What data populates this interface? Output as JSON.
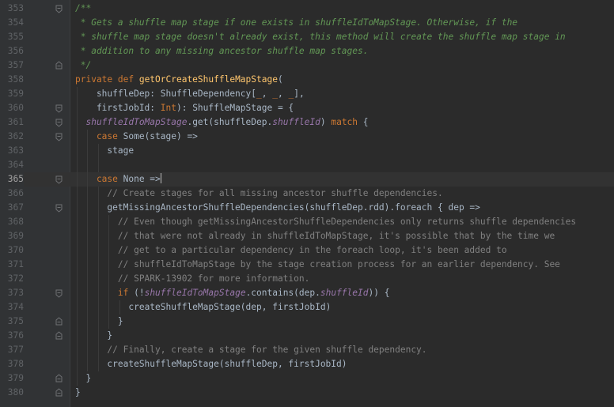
{
  "editor": {
    "current_line": 365,
    "lines": [
      {
        "num": "353",
        "fold": "fold-open",
        "indent": 0,
        "guides": [],
        "tokens": [
          {
            "t": "/**",
            "c": "doc"
          }
        ]
      },
      {
        "num": "354",
        "fold": "",
        "indent": 0,
        "guides": [],
        "tokens": [
          {
            "t": " * Gets a shuffle map stage if one exists in shuffleIdToMapStage. Otherwise, if the",
            "c": "doc"
          }
        ]
      },
      {
        "num": "355",
        "fold": "",
        "indent": 0,
        "guides": [],
        "tokens": [
          {
            "t": " * shuffle map stage doesn't already exist, this method will create the shuffle map stage in",
            "c": "doc"
          }
        ]
      },
      {
        "num": "356",
        "fold": "",
        "indent": 0,
        "guides": [],
        "tokens": [
          {
            "t": " * addition to any missing ancestor shuffle map stages.",
            "c": "doc"
          }
        ]
      },
      {
        "num": "357",
        "fold": "fold-close",
        "indent": 0,
        "guides": [],
        "tokens": [
          {
            "t": " */",
            "c": "doc"
          }
        ]
      },
      {
        "num": "358",
        "fold": "",
        "indent": 0,
        "guides": [],
        "tokens": [
          {
            "t": "private def ",
            "c": "kw"
          },
          {
            "t": "getOrCreateShuffleMapStage",
            "c": "fn"
          },
          {
            "t": "(",
            "c": "id"
          }
        ]
      },
      {
        "num": "359",
        "fold": "",
        "indent": 4,
        "guides": [
          0
        ],
        "tokens": [
          {
            "t": "shuffleDep: ShuffleDependency[",
            "c": "id"
          },
          {
            "t": "_",
            "c": "kw"
          },
          {
            "t": ", ",
            "c": "id"
          },
          {
            "t": "_",
            "c": "kw"
          },
          {
            "t": ", ",
            "c": "id"
          },
          {
            "t": "_",
            "c": "kw"
          },
          {
            "t": "],",
            "c": "id"
          }
        ]
      },
      {
        "num": "360",
        "fold": "fold-open",
        "indent": 4,
        "guides": [
          0
        ],
        "tokens": [
          {
            "t": "firstJobId: ",
            "c": "id"
          },
          {
            "t": "Int",
            "c": "kw"
          },
          {
            "t": "): ShuffleMapStage = {",
            "c": "id"
          }
        ]
      },
      {
        "num": "361",
        "fold": "fold-open",
        "indent": 2,
        "guides": [
          0
        ],
        "tokens": [
          {
            "t": "shuffleIdToMapStage",
            "c": "field"
          },
          {
            "t": ".get(shuffleDep.",
            "c": "id"
          },
          {
            "t": "shuffleId",
            "c": "field"
          },
          {
            "t": ") ",
            "c": "id"
          },
          {
            "t": "match",
            "c": "kw"
          },
          {
            "t": " {",
            "c": "id"
          }
        ]
      },
      {
        "num": "362",
        "fold": "fold-open",
        "indent": 4,
        "guides": [
          0,
          2
        ],
        "tokens": [
          {
            "t": "case ",
            "c": "kw"
          },
          {
            "t": "Some(stage) =>",
            "c": "id"
          }
        ]
      },
      {
        "num": "363",
        "fold": "",
        "indent": 6,
        "guides": [
          0,
          2,
          4
        ],
        "tokens": [
          {
            "t": "stage",
            "c": "id"
          }
        ]
      },
      {
        "num": "364",
        "fold": "",
        "indent": 0,
        "guides": [
          0,
          2,
          4
        ],
        "tokens": []
      },
      {
        "num": "365",
        "fold": "fold-open",
        "indent": 4,
        "guides": [
          0,
          2
        ],
        "caret": true,
        "tokens": [
          {
            "t": "case ",
            "c": "kw"
          },
          {
            "t": "None =>",
            "c": "id"
          }
        ]
      },
      {
        "num": "366",
        "fold": "",
        "indent": 6,
        "guides": [
          0,
          2,
          4
        ],
        "tokens": [
          {
            "t": "// Create stages for all missing ancestor shuffle dependencies.",
            "c": "cm"
          }
        ]
      },
      {
        "num": "367",
        "fold": "fold-open",
        "indent": 6,
        "guides": [
          0,
          2,
          4
        ],
        "tokens": [
          {
            "t": "getMissingAncestorShuffleDependencies(shuffleDep.rdd).foreach { dep =>",
            "c": "id"
          }
        ]
      },
      {
        "num": "368",
        "fold": "",
        "indent": 8,
        "guides": [
          0,
          2,
          4,
          6
        ],
        "tokens": [
          {
            "t": "// Even though getMissingAncestorShuffleDependencies only returns shuffle dependencies",
            "c": "cm"
          }
        ]
      },
      {
        "num": "369",
        "fold": "",
        "indent": 8,
        "guides": [
          0,
          2,
          4,
          6
        ],
        "tokens": [
          {
            "t": "// that were not already in shuffleIdToMapStage, it's possible that by the time we",
            "c": "cm"
          }
        ]
      },
      {
        "num": "370",
        "fold": "",
        "indent": 8,
        "guides": [
          0,
          2,
          4,
          6
        ],
        "tokens": [
          {
            "t": "// get to a particular dependency in the foreach loop, it's been added to",
            "c": "cm"
          }
        ]
      },
      {
        "num": "371",
        "fold": "",
        "indent": 8,
        "guides": [
          0,
          2,
          4,
          6
        ],
        "tokens": [
          {
            "t": "// shuffleIdToMapStage by the stage creation process for an earlier dependency. See",
            "c": "cm"
          }
        ]
      },
      {
        "num": "372",
        "fold": "",
        "indent": 8,
        "guides": [
          0,
          2,
          4,
          6
        ],
        "tokens": [
          {
            "t": "// SPARK-13902 for more information.",
            "c": "cm"
          }
        ]
      },
      {
        "num": "373",
        "fold": "fold-open",
        "indent": 8,
        "guides": [
          0,
          2,
          4,
          6
        ],
        "tokens": [
          {
            "t": "if ",
            "c": "kw"
          },
          {
            "t": "(!",
            "c": "id"
          },
          {
            "t": "shuffleIdToMapStage",
            "c": "field"
          },
          {
            "t": ".contains(dep.",
            "c": "id"
          },
          {
            "t": "shuffleId",
            "c": "field"
          },
          {
            "t": ")) {",
            "c": "id"
          }
        ]
      },
      {
        "num": "374",
        "fold": "",
        "indent": 10,
        "guides": [
          0,
          2,
          4,
          6,
          8
        ],
        "tokens": [
          {
            "t": "createShuffleMapStage(dep, firstJobId)",
            "c": "id"
          }
        ]
      },
      {
        "num": "375",
        "fold": "fold-close",
        "indent": 8,
        "guides": [
          0,
          2,
          4,
          6
        ],
        "tokens": [
          {
            "t": "}",
            "c": "id"
          }
        ]
      },
      {
        "num": "376",
        "fold": "fold-close",
        "indent": 6,
        "guides": [
          0,
          2,
          4
        ],
        "tokens": [
          {
            "t": "}",
            "c": "id"
          }
        ]
      },
      {
        "num": "377",
        "fold": "",
        "indent": 6,
        "guides": [
          0,
          2,
          4
        ],
        "tokens": [
          {
            "t": "// Finally, create a stage for the given shuffle dependency.",
            "c": "cm"
          }
        ]
      },
      {
        "num": "378",
        "fold": "",
        "indent": 6,
        "guides": [
          0,
          2,
          4
        ],
        "tokens": [
          {
            "t": "createShuffleMapStage(shuffleDep, firstJobId)",
            "c": "id"
          }
        ]
      },
      {
        "num": "379",
        "fold": "fold-close",
        "indent": 2,
        "guides": [
          0
        ],
        "tokens": [
          {
            "t": "}",
            "c": "id"
          }
        ]
      },
      {
        "num": "380",
        "fold": "fold-close",
        "indent": 0,
        "guides": [],
        "tokens": [
          {
            "t": "}",
            "c": "id"
          }
        ]
      }
    ]
  },
  "colors": {
    "background": "#2b2b2b",
    "gutter": "#313335",
    "doc_comment": "#629755",
    "keyword": "#cc7832",
    "function": "#ffc66d",
    "field": "#9876aa",
    "comment": "#808080",
    "identifier": "#a9b7c6"
  }
}
